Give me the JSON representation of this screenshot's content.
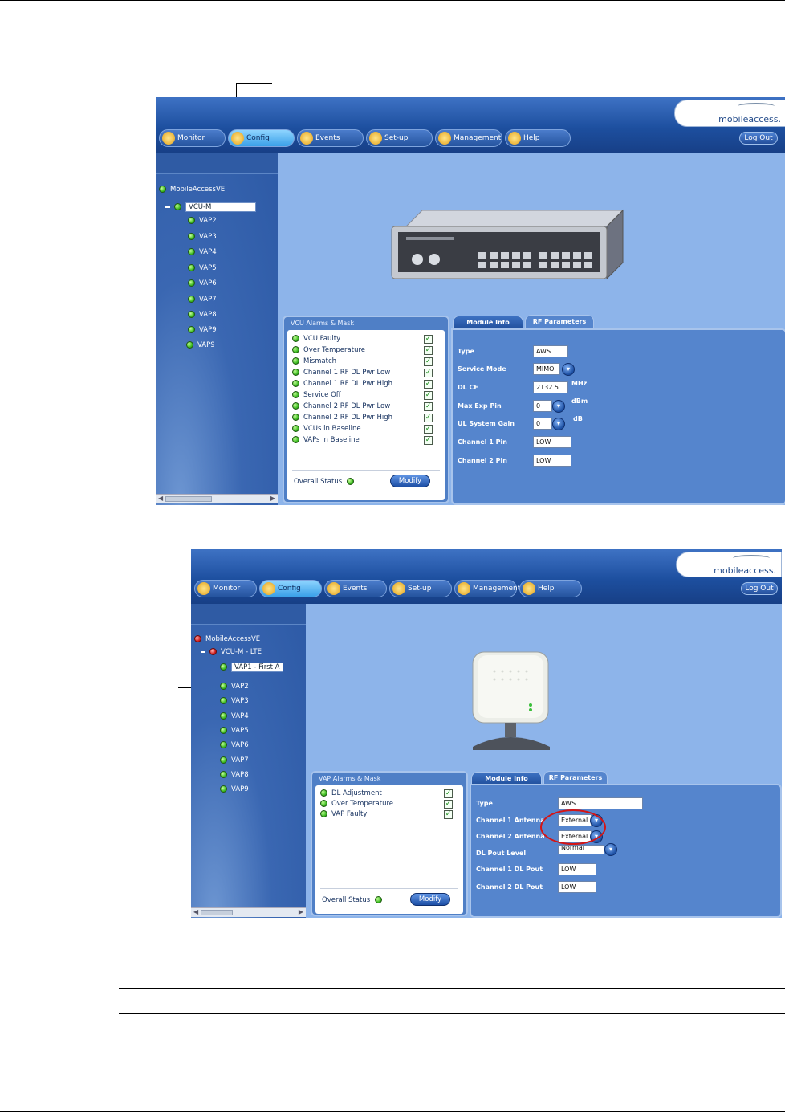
{
  "screenshot1": {
    "logo": "mobileaccess.",
    "tabs": [
      "Monitor",
      "Config",
      "Events",
      "Set-up",
      "Management",
      "Help"
    ],
    "active_tab": "Config",
    "logout": "Log Out",
    "tree": {
      "root": "MobileAccessVE",
      "parent": "VCU-M",
      "children": [
        "VAP2",
        "VAP3",
        "VAP4",
        "VAP5",
        "VAP6",
        "VAP7",
        "VAP8",
        "VAP9",
        "VAP9"
      ]
    },
    "alarms_title": "VCU Alarms & Mask",
    "alarms": [
      "VCU Faulty",
      "Over Temperature",
      "Mismatch",
      "Channel 1 RF DL Pwr Low",
      "Channel 1 RF DL Pwr High",
      "Service Off",
      "Channel 2 RF DL Pwr Low",
      "Channel 2 RF DL Pwr High",
      "VCUs in Baseline",
      "VAPs in Baseline"
    ],
    "overall_status": "Overall Status",
    "modify": "Modify",
    "right_tabs": [
      "Module Info",
      "RF Parameters"
    ],
    "rf": {
      "labels": [
        "Type",
        "Service Mode",
        "DL CF",
        "Max Exp Pin",
        "UL System Gain",
        "Channel 1 Pin",
        "Channel 2 Pin"
      ],
      "values": [
        "AWS",
        "MIMO",
        "2132.5",
        "0",
        "0",
        "LOW",
        "LOW"
      ],
      "units": {
        "dlcf": "MHz",
        "maxexp": "dBm",
        "ulgain": "dB"
      }
    }
  },
  "screenshot2": {
    "logo": "mobileaccess.",
    "tabs": [
      "Monitor",
      "Config",
      "Events",
      "Set-up",
      "Management",
      "Help"
    ],
    "active_tab": "Config",
    "logout": "Log Out",
    "tree": {
      "root": "MobileAccessVE",
      "parent": "VCU-M - LTE",
      "children": [
        "VAP1 - First A",
        "VAP2",
        "VAP3",
        "VAP4",
        "VAP5",
        "VAP6",
        "VAP7",
        "VAP8",
        "VAP9"
      ]
    },
    "alarms_title": "VAP Alarms & Mask",
    "alarms": [
      "DL Adjustment",
      "Over Temperature",
      "VAP Faulty"
    ],
    "overall_status": "Overall Status",
    "modify": "Modify",
    "right_tabs": [
      "Module Info",
      "RF Parameters"
    ],
    "rf": {
      "labels": [
        "Type",
        "Channel 1 Antenna",
        "Channel 2 Antenna",
        "DL Pout Level",
        "Channel 1 DL Pout",
        "Channel 2 DL Pout"
      ],
      "values": [
        "AWS",
        "External",
        "External",
        "Normal",
        "LOW",
        "LOW"
      ]
    }
  }
}
